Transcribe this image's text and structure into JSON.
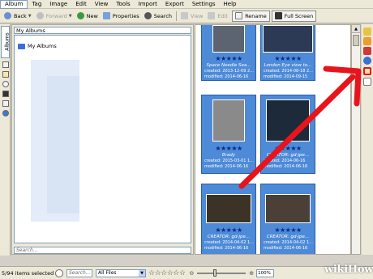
{
  "menu": [
    "Album",
    "Tag",
    "Image",
    "Edit",
    "View",
    "Tools",
    "Import",
    "Export",
    "Settings",
    "Help"
  ],
  "toolbar": {
    "back": "Back",
    "forward": "Forward",
    "new": "New",
    "properties": "Properties",
    "search": "Search",
    "view": "View",
    "edit": "Edit",
    "rename": "Rename",
    "fullscreen": "Full Screen"
  },
  "left_tab": "Albums",
  "albums": {
    "header": "My Albums",
    "root": "My Albums",
    "search_placeholder": "Search..."
  },
  "thumbnails": [
    {
      "caption": "Space Needle Sea...",
      "created": "created: 2013-12-09 2...",
      "modified": "modified: 2014-06-16"
    },
    {
      "caption": "London Eye view to...",
      "created": "created: 2014-08-18 2...",
      "modified": "modified: 2014-09-15"
    },
    {
      "caption": "Brady",
      "created": "created: 2015-03-01 1...",
      "modified": "modified: 2014-06-16"
    },
    {
      "caption": "CREATOR: gd-jpe...",
      "created": "created: 2014-06-16",
      "modified": "modified: 2014-06-16"
    },
    {
      "caption": "CREATOR: gd-jpe...",
      "created": "created: 2014-04-02 1...",
      "modified": "modified: 2014-06-16"
    },
    {
      "caption": "CREATOR: gd-jpe...",
      "created": "created: 2014-04-02 1...",
      "modified": "modified: 2014-06-16"
    }
  ],
  "status": {
    "count": "5/94 items selected",
    "search_placeholder": "Search...",
    "filter": "All Files",
    "zoom": "100%"
  },
  "watermark": "wikiHow",
  "colors": {
    "selection": "#4d8ad8",
    "arrow": "#e8141c",
    "stars": "#0b2a87"
  }
}
